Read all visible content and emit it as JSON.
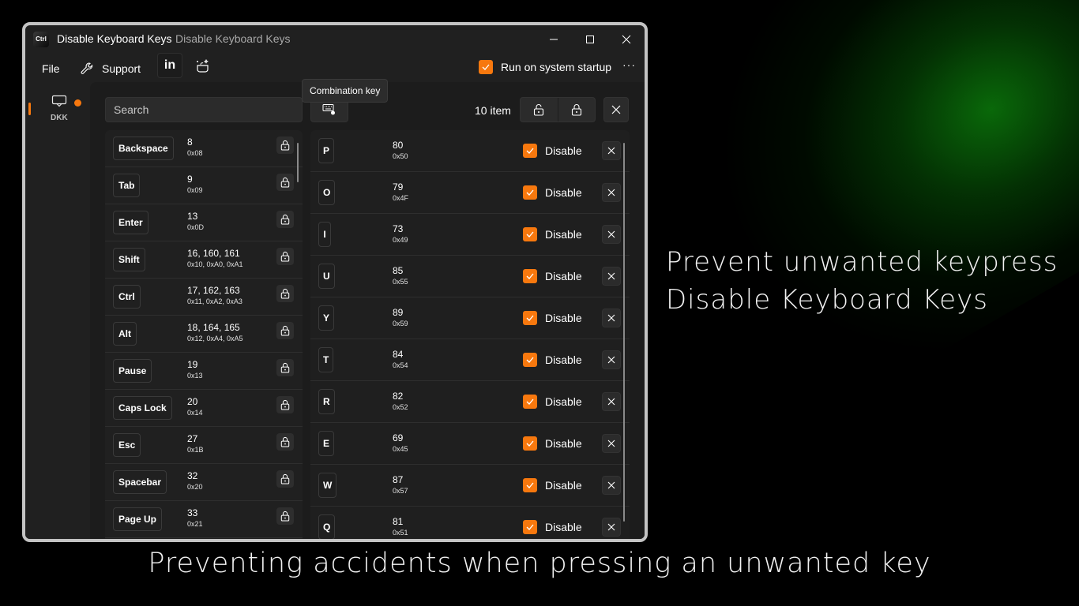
{
  "window": {
    "app_icon_text": "Ctrl",
    "title": "Disable Keyboard Keys",
    "subtitle": "Disable Keyboard Keys",
    "minimize": "—",
    "maximize": "☐",
    "close": "✕"
  },
  "menu": {
    "file": "File",
    "support": "Support",
    "linkedin": "in",
    "startup_label": "Run on system startup",
    "startup_checked": true,
    "more": "···"
  },
  "nav": {
    "items": [
      {
        "label": "DKK",
        "icon": "monitor-icon",
        "active": true,
        "badge": true
      }
    ]
  },
  "toolbar": {
    "search_placeholder": "Search",
    "combo_tooltip": "Combination key",
    "item_count": "10 item"
  },
  "available_keys": [
    {
      "name": "Backspace",
      "dec": "8",
      "hex": "0x08"
    },
    {
      "name": "Tab",
      "dec": "9",
      "hex": "0x09"
    },
    {
      "name": "Enter",
      "dec": "13",
      "hex": "0x0D"
    },
    {
      "name": "Shift",
      "dec": "16, 160, 161",
      "hex": "0x10, 0xA0, 0xA1"
    },
    {
      "name": "Ctrl",
      "dec": "17, 162, 163",
      "hex": "0x11, 0xA2, 0xA3"
    },
    {
      "name": "Alt",
      "dec": "18, 164, 165",
      "hex": "0x12, 0xA4, 0xA5"
    },
    {
      "name": "Pause",
      "dec": "19",
      "hex": "0x13"
    },
    {
      "name": "Caps Lock",
      "dec": "20",
      "hex": "0x14"
    },
    {
      "name": "Esc",
      "dec": "27",
      "hex": "0x1B"
    },
    {
      "name": "Spacebar",
      "dec": "32",
      "hex": "0x20"
    },
    {
      "name": "Page Up",
      "dec": "33",
      "hex": "0x21"
    }
  ],
  "disabled_keys": [
    {
      "name": "P",
      "dec": "80",
      "hex": "0x50",
      "label": "Disable",
      "checked": true
    },
    {
      "name": "O",
      "dec": "79",
      "hex": "0x4F",
      "label": "Disable",
      "checked": true
    },
    {
      "name": "I",
      "dec": "73",
      "hex": "0x49",
      "label": "Disable",
      "checked": true
    },
    {
      "name": "U",
      "dec": "85",
      "hex": "0x55",
      "label": "Disable",
      "checked": true
    },
    {
      "name": "Y",
      "dec": "89",
      "hex": "0x59",
      "label": "Disable",
      "checked": true
    },
    {
      "name": "T",
      "dec": "84",
      "hex": "0x54",
      "label": "Disable",
      "checked": true
    },
    {
      "name": "R",
      "dec": "82",
      "hex": "0x52",
      "label": "Disable",
      "checked": true
    },
    {
      "name": "E",
      "dec": "69",
      "hex": "0x45",
      "label": "Disable",
      "checked": true
    },
    {
      "name": "W",
      "dec": "87",
      "hex": "0x57",
      "label": "Disable",
      "checked": true
    },
    {
      "name": "Q",
      "dec": "81",
      "hex": "0x51",
      "label": "Disable",
      "checked": true
    }
  ],
  "promo": {
    "line1": "Prevent unwanted keypress",
    "line2": "Disable Keyboard Keys",
    "tagline": "Preventing accidents when pressing an unwanted key"
  },
  "colors": {
    "accent": "#f7780e",
    "window_bg": "#202020",
    "glow": "#0a6e0a"
  }
}
